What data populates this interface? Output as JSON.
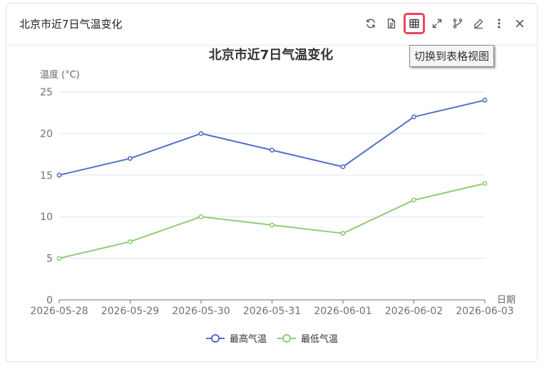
{
  "card": {
    "title": "北京市近7日气温变化"
  },
  "toolbar": {
    "items": [
      {
        "name": "refresh-icon",
        "label": ""
      },
      {
        "name": "document-icon",
        "label": ""
      },
      {
        "name": "table-icon",
        "label": "",
        "active": true
      },
      {
        "name": "expand-icon",
        "label": ""
      },
      {
        "name": "branch-icon",
        "label": ""
      },
      {
        "name": "edit-icon",
        "label": ""
      },
      {
        "name": "more-icon",
        "label": ""
      },
      {
        "name": "close-icon",
        "label": ""
      }
    ],
    "tooltip": "切换到表格视图",
    "accent_color": "#f0435c"
  },
  "chart_data": {
    "type": "line",
    "title": "北京市近7日气温变化",
    "xlabel": "日期",
    "ylabel": "温度 (°C)",
    "categories": [
      "2026-05-28",
      "2026-05-29",
      "2026-05-30",
      "2026-05-31",
      "2026-06-01",
      "2026-06-02",
      "2026-06-03"
    ],
    "ylim": [
      0,
      25
    ],
    "yticks": [
      0,
      5,
      10,
      15,
      20,
      25
    ],
    "grid": true,
    "legend_position": "bottom-center",
    "series": [
      {
        "name": "最高气温",
        "values": [
          15,
          17,
          20,
          18,
          16,
          22,
          24
        ],
        "color": "#5470c6"
      },
      {
        "name": "最低气温",
        "values": [
          5,
          7,
          10,
          9,
          8,
          12,
          14
        ],
        "color": "#91cc75"
      }
    ]
  }
}
